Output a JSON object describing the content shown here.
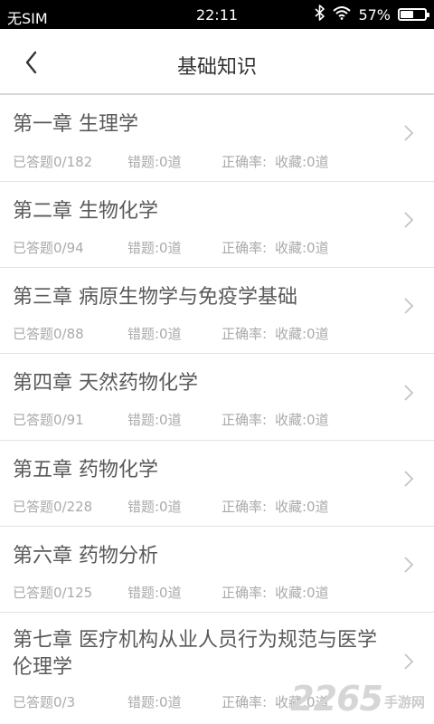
{
  "status_bar": {
    "carrier": "无SIM",
    "time": "22:11",
    "battery_text": "57%",
    "battery_level": 0.57
  },
  "nav": {
    "title": "基础知识"
  },
  "chapters": [
    {
      "title": "第一章 生理学",
      "answered": "已答题0/182",
      "wrong": "错题:0道",
      "accuracy": "正确率:",
      "favorites": "收藏:0道"
    },
    {
      "title": "第二章 生物化学",
      "answered": "已答题0/94",
      "wrong": "错题:0道",
      "accuracy": "正确率:",
      "favorites": "收藏:0道"
    },
    {
      "title": "第三章 病原生物学与免疫学基础",
      "answered": "已答题0/88",
      "wrong": "错题:0道",
      "accuracy": "正确率:",
      "favorites": "收藏:0道"
    },
    {
      "title": "第四章 天然药物化学",
      "answered": "已答题0/91",
      "wrong": "错题:0道",
      "accuracy": "正确率:",
      "favorites": "收藏:0道"
    },
    {
      "title": "第五章 药物化学",
      "answered": "已答题0/228",
      "wrong": "错题:0道",
      "accuracy": "正确率:",
      "favorites": "收藏:0道"
    },
    {
      "title": "第六章 药物分析",
      "answered": "已答题0/125",
      "wrong": "错题:0道",
      "accuracy": "正确率:",
      "favorites": "收藏:0道"
    },
    {
      "title": "第七章 医疗机构从业人员行为规范与医学伦理学",
      "answered": "已答题0/3",
      "wrong": "错题:0道",
      "accuracy": "正确率:",
      "favorites": "收藏:0道"
    }
  ],
  "watermark": {
    "number": "2265",
    "site": "手游网"
  },
  "colors": {
    "status_bg": "#000000",
    "title_text": "#333333",
    "chapter_text": "#5a5a5a",
    "stats_text": "#aaaaaa"
  }
}
